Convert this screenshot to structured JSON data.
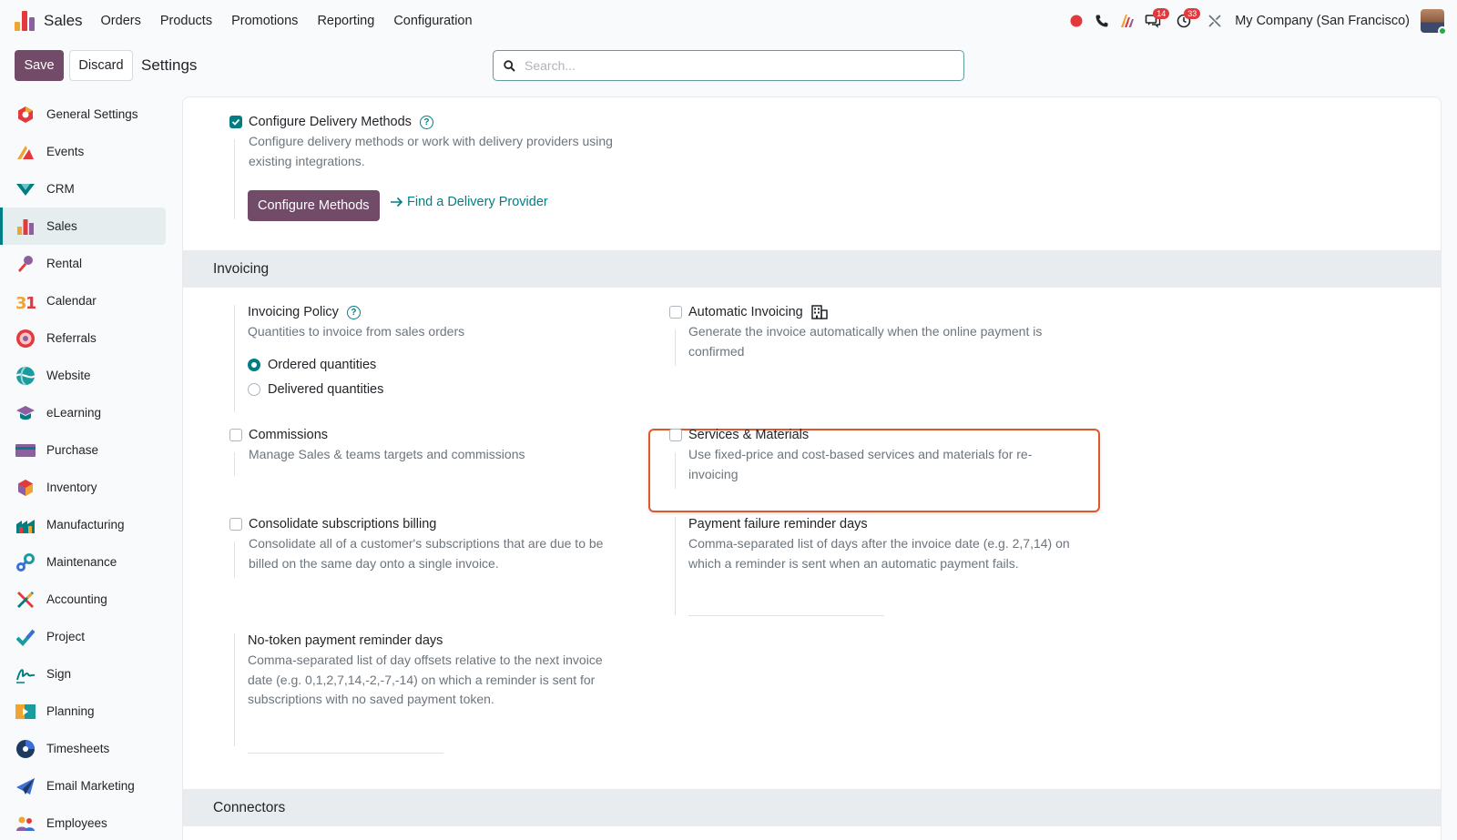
{
  "colors": {
    "brand": "#714b67",
    "accent": "#017e84",
    "highlight": "#e0572e",
    "badge": "#e4393c"
  },
  "navbar": {
    "app_name": "Sales",
    "menu": [
      "Orders",
      "Products",
      "Promotions",
      "Reporting",
      "Configuration"
    ],
    "messages_badge": "14",
    "activities_badge": "33",
    "company": "My Company (San Francisco)"
  },
  "control": {
    "save_label": "Save",
    "discard_label": "Discard",
    "title": "Settings",
    "search_placeholder": "Search..."
  },
  "sidebar": {
    "items": [
      {
        "label": "General Settings",
        "icon": "general-settings-icon"
      },
      {
        "label": "Events",
        "icon": "events-icon"
      },
      {
        "label": "CRM",
        "icon": "crm-icon"
      },
      {
        "label": "Sales",
        "icon": "sales-icon",
        "active": true
      },
      {
        "label": "Rental",
        "icon": "rental-icon"
      },
      {
        "label": "Calendar",
        "icon": "calendar-icon"
      },
      {
        "label": "Referrals",
        "icon": "referrals-icon"
      },
      {
        "label": "Website",
        "icon": "website-icon"
      },
      {
        "label": "eLearning",
        "icon": "elearning-icon"
      },
      {
        "label": "Purchase",
        "icon": "purchase-icon"
      },
      {
        "label": "Inventory",
        "icon": "inventory-icon"
      },
      {
        "label": "Manufacturing",
        "icon": "manufacturing-icon"
      },
      {
        "label": "Maintenance",
        "icon": "maintenance-icon"
      },
      {
        "label": "Accounting",
        "icon": "accounting-icon"
      },
      {
        "label": "Project",
        "icon": "project-icon"
      },
      {
        "label": "Sign",
        "icon": "sign-icon"
      },
      {
        "label": "Planning",
        "icon": "planning-icon"
      },
      {
        "label": "Timesheets",
        "icon": "timesheets-icon"
      },
      {
        "label": "Email Marketing",
        "icon": "email-marketing-icon"
      },
      {
        "label": "Employees",
        "icon": "employees-icon"
      }
    ]
  },
  "delivery": {
    "title": "Configure Delivery Methods",
    "checked": true,
    "desc_line1": "Configure delivery methods or work with delivery providers using",
    "desc_line2": "existing integrations.",
    "button": "Configure Methods",
    "link": "Find a Delivery Provider"
  },
  "invoicing": {
    "header": "Invoicing",
    "policy": {
      "title": "Invoicing Policy",
      "desc": "Quantities to invoice from sales orders",
      "options": [
        "Ordered quantities",
        "Delivered quantities"
      ],
      "selected": "Ordered quantities"
    },
    "auto": {
      "title": "Automatic Invoicing",
      "checked": false,
      "desc_line1": "Generate the invoice automatically when the online payment is",
      "desc_line2": "confirmed"
    },
    "commissions": {
      "title": "Commissions",
      "checked": false,
      "desc": "Manage Sales & teams targets and commissions"
    },
    "services": {
      "title": "Services & Materials",
      "checked": false,
      "desc_line1": "Use fixed-price and cost-based services and materials for re-",
      "desc_line2": "invoicing"
    },
    "consolidate": {
      "title": "Consolidate subscriptions billing",
      "checked": false,
      "desc_line1": "Consolidate all of a customer's subscriptions that are due to be",
      "desc_line2": "billed on the same day onto a single invoice."
    },
    "payment_failure": {
      "title": "Payment failure reminder days",
      "desc_line1": "Comma-separated list of days after the invoice date (e.g. 2,7,14) on",
      "desc_line2": "which a reminder is sent when an automatic payment fails."
    },
    "no_token": {
      "title": "No-token payment reminder days",
      "desc_line1": "Comma-separated list of day offsets relative to the next invoice",
      "desc_line2": "date (e.g. 0,1,2,7,14,-2,-7,-14) on which a reminder is sent for",
      "desc_line3": "subscriptions with no saved payment token."
    }
  },
  "connectors": {
    "header": "Connectors"
  }
}
